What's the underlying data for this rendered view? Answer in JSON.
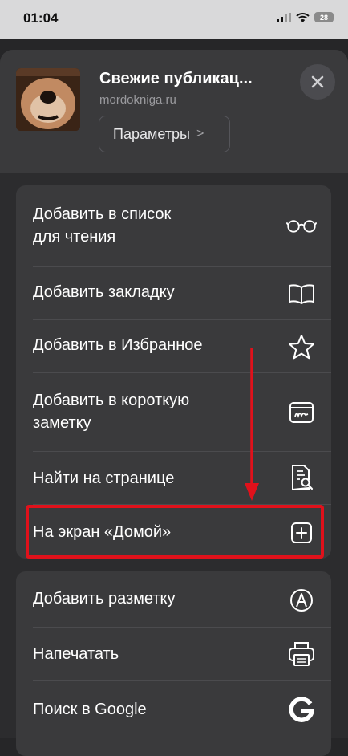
{
  "status_bar": {
    "time": "01:04",
    "battery": "28"
  },
  "header": {
    "title": "Свежие публикац...",
    "url": "mordokniga.ru",
    "params_label": "Параметры",
    "params_chevron": ">",
    "close_icon": "close-icon"
  },
  "menu_group_1": [
    {
      "label": "Добавить в список\nдля чтения",
      "icon": "reading-glasses-icon"
    },
    {
      "label": "Добавить закладку",
      "icon": "book-icon"
    },
    {
      "label": "Добавить в Избранное",
      "icon": "star-icon"
    },
    {
      "label": "Добавить в короткую\nзаметку",
      "icon": "quick-note-icon"
    },
    {
      "label": "Найти на странице",
      "icon": "find-on-page-icon"
    },
    {
      "label": "На экран «Домой»",
      "icon": "add-square-icon"
    }
  ],
  "menu_group_2": [
    {
      "label": "Добавить разметку",
      "icon": "markup-pen-icon"
    },
    {
      "label": "Напечатать",
      "icon": "printer-icon"
    },
    {
      "label": "Поиск в Google",
      "icon": "google-icon"
    }
  ],
  "annotation": {
    "color": "#e0111b",
    "target": "На экран «Домой»"
  }
}
